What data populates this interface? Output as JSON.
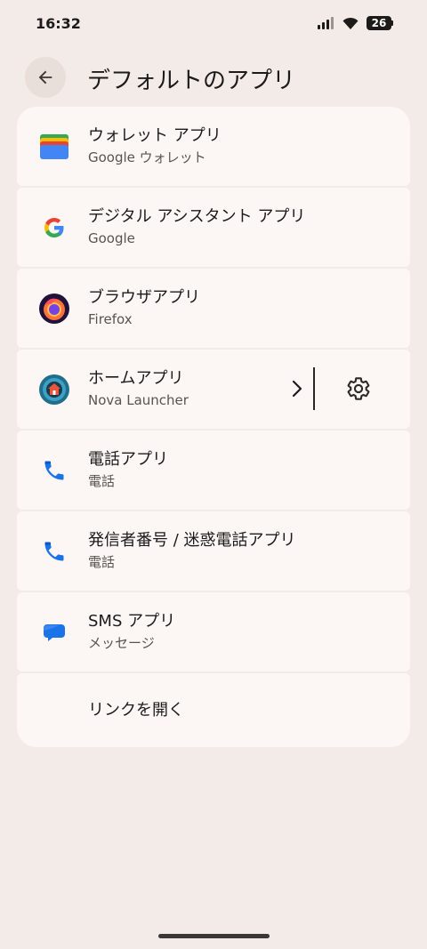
{
  "status_bar": {
    "time": "16:32",
    "battery": "26"
  },
  "header": {
    "title": "デフォルトのアプリ"
  },
  "items": [
    {
      "title": "ウォレット アプリ",
      "subtitle": "Google ウォレット"
    },
    {
      "title": "デジタル アシスタント アプリ",
      "subtitle": "Google"
    },
    {
      "title": "ブラウザアプリ",
      "subtitle": "Firefox"
    },
    {
      "title": "ホームアプリ",
      "subtitle": "Nova Launcher"
    },
    {
      "title": "電話アプリ",
      "subtitle": "電話"
    },
    {
      "title": "発信者番号 / 迷惑電話アプリ",
      "subtitle": "電話"
    },
    {
      "title": "SMS アプリ",
      "subtitle": "メッセージ"
    },
    {
      "title": "リンクを開く"
    }
  ],
  "colors": {
    "background": "#f3ebe8",
    "card": "#fcf7f4",
    "text": "#1d1b1a"
  },
  "icons": [
    "wallet-icon",
    "google-icon",
    "firefox-icon",
    "nova-launcher-icon",
    "phone-icon",
    "messages-icon",
    "gear-icon",
    "back-arrow-icon",
    "chevron-right-icon"
  ]
}
